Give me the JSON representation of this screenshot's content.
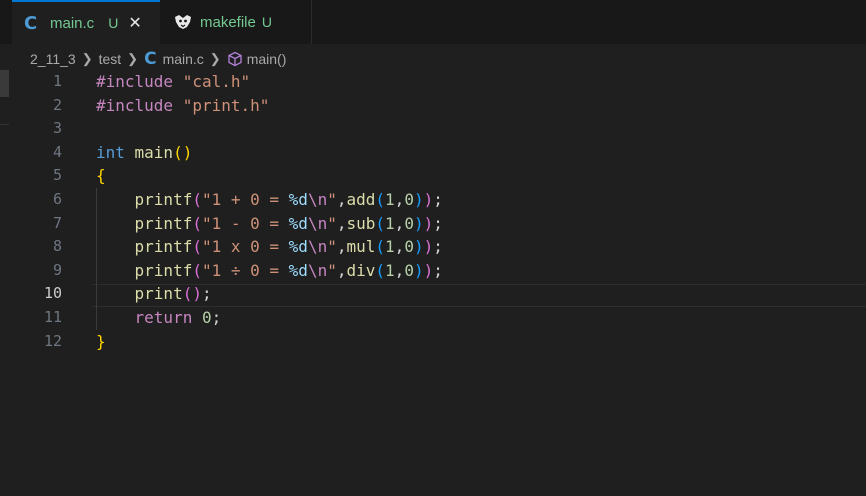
{
  "tabs": [
    {
      "icon": "c-language-icon",
      "icon_glyph": "C",
      "name": "main.c",
      "badge": "U",
      "close": "✕"
    },
    {
      "icon": "makefile-icon",
      "name": "makefile",
      "badge": "U"
    }
  ],
  "breadcrumb": {
    "items": [
      "2_11_3",
      "test",
      "main.c",
      "main()"
    ],
    "c_glyph": "C"
  },
  "editor": {
    "active_line": 10,
    "lines": [
      {
        "n": "1",
        "tokens": [
          {
            "t": "#include ",
            "c": "kw-inc"
          },
          {
            "t": "\"cal.h\"",
            "c": "str"
          }
        ]
      },
      {
        "n": "2",
        "tokens": [
          {
            "t": "#include ",
            "c": "kw-inc"
          },
          {
            "t": "\"print.h\"",
            "c": "str"
          }
        ]
      },
      {
        "n": "3",
        "tokens": []
      },
      {
        "n": "4",
        "tokens": [
          {
            "t": "int ",
            "c": "kw"
          },
          {
            "t": "main",
            "c": "fn"
          },
          {
            "t": "()",
            "c": "br1"
          }
        ]
      },
      {
        "n": "5",
        "tokens": [
          {
            "t": "{",
            "c": "br1"
          }
        ]
      },
      {
        "n": "6",
        "tokens": [
          {
            "t": "    printf",
            "c": "fn"
          },
          {
            "t": "(",
            "c": "br2"
          },
          {
            "t": "\"1 + 0 = ",
            "c": "str"
          },
          {
            "t": "%d",
            "c": "fmt"
          },
          {
            "t": "\\n",
            "c": "ctrl"
          },
          {
            "t": "\"",
            "c": "str"
          },
          {
            "t": ",",
            "c": "plain"
          },
          {
            "t": "add",
            "c": "fn"
          },
          {
            "t": "(",
            "c": "br3"
          },
          {
            "t": "1",
            "c": "num"
          },
          {
            "t": ",",
            "c": "plain"
          },
          {
            "t": "0",
            "c": "num"
          },
          {
            "t": ")",
            "c": "br3"
          },
          {
            "t": ")",
            "c": "br2"
          },
          {
            "t": ";",
            "c": "plain"
          }
        ]
      },
      {
        "n": "7",
        "tokens": [
          {
            "t": "    printf",
            "c": "fn"
          },
          {
            "t": "(",
            "c": "br2"
          },
          {
            "t": "\"1 - 0 = ",
            "c": "str"
          },
          {
            "t": "%d",
            "c": "fmt"
          },
          {
            "t": "\\n",
            "c": "ctrl"
          },
          {
            "t": "\"",
            "c": "str"
          },
          {
            "t": ",",
            "c": "plain"
          },
          {
            "t": "sub",
            "c": "fn"
          },
          {
            "t": "(",
            "c": "br3"
          },
          {
            "t": "1",
            "c": "num"
          },
          {
            "t": ",",
            "c": "plain"
          },
          {
            "t": "0",
            "c": "num"
          },
          {
            "t": ")",
            "c": "br3"
          },
          {
            "t": ")",
            "c": "br2"
          },
          {
            "t": ";",
            "c": "plain"
          }
        ]
      },
      {
        "n": "8",
        "tokens": [
          {
            "t": "    printf",
            "c": "fn"
          },
          {
            "t": "(",
            "c": "br2"
          },
          {
            "t": "\"1 x 0 = ",
            "c": "str"
          },
          {
            "t": "%d",
            "c": "fmt"
          },
          {
            "t": "\\n",
            "c": "ctrl"
          },
          {
            "t": "\"",
            "c": "str"
          },
          {
            "t": ",",
            "c": "plain"
          },
          {
            "t": "mul",
            "c": "fn"
          },
          {
            "t": "(",
            "c": "br3"
          },
          {
            "t": "1",
            "c": "num"
          },
          {
            "t": ",",
            "c": "plain"
          },
          {
            "t": "0",
            "c": "num"
          },
          {
            "t": ")",
            "c": "br3"
          },
          {
            "t": ")",
            "c": "br2"
          },
          {
            "t": ";",
            "c": "plain"
          }
        ]
      },
      {
        "n": "9",
        "tokens": [
          {
            "t": "    printf",
            "c": "fn"
          },
          {
            "t": "(",
            "c": "br2"
          },
          {
            "t": "\"1 ÷ 0 = ",
            "c": "str"
          },
          {
            "t": "%d",
            "c": "fmt"
          },
          {
            "t": "\\n",
            "c": "ctrl"
          },
          {
            "t": "\"",
            "c": "str"
          },
          {
            "t": ",",
            "c": "plain"
          },
          {
            "t": "div",
            "c": "fn"
          },
          {
            "t": "(",
            "c": "br3"
          },
          {
            "t": "1",
            "c": "num"
          },
          {
            "t": ",",
            "c": "plain"
          },
          {
            "t": "0",
            "c": "num"
          },
          {
            "t": ")",
            "c": "br3"
          },
          {
            "t": ")",
            "c": "br2"
          },
          {
            "t": ";",
            "c": "plain"
          }
        ]
      },
      {
        "n": "10",
        "tokens": [
          {
            "t": "    print",
            "c": "fn"
          },
          {
            "t": "()",
            "c": "br2"
          },
          {
            "t": ";",
            "c": "plain"
          }
        ]
      },
      {
        "n": "11",
        "tokens": [
          {
            "t": "    return ",
            "c": "ctrl"
          },
          {
            "t": "0",
            "c": "num"
          },
          {
            "t": ";",
            "c": "plain"
          }
        ]
      },
      {
        "n": "12",
        "tokens": [
          {
            "t": "}",
            "c": "br1"
          }
        ]
      }
    ]
  },
  "colors": {
    "background": "#1f1f1f",
    "tabbar": "#181818",
    "accent": "#0078d4",
    "untracked": "#73c991"
  }
}
